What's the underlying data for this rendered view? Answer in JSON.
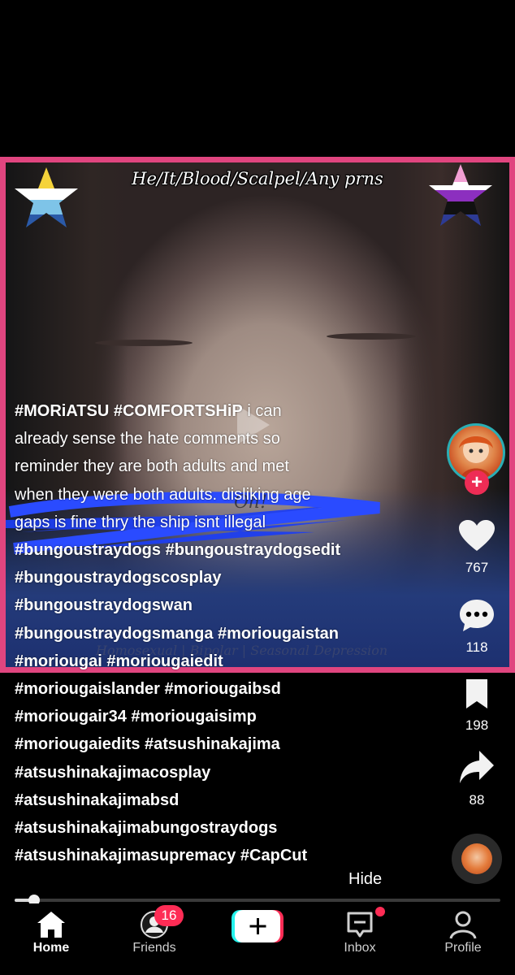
{
  "video": {
    "overlay_top_text": "He/It/Blood/Scalpel/Any prns",
    "overlay_mid_text": "Oh!",
    "overlay_bottom_text": "Homosexual | Bipolar | Seasonal Depression",
    "left_flag_colors": [
      "#f5d33a",
      "#ffffff",
      "#7ec4e8",
      "#2b5aa8"
    ],
    "right_flag_colors": [
      "#f29fd3",
      "#ffffff",
      "#8c2fbf",
      "#111111",
      "#2d3b94"
    ]
  },
  "caption": {
    "lines": [
      {
        "bold": "#MORiATSU #COMFORTSHiP",
        "text": " i can"
      },
      {
        "bold": "",
        "text": "already sense the hate comments so"
      },
      {
        "bold": "",
        "text": "reminder they are both adults and met"
      },
      {
        "bold": "",
        "text": "when they were both adults. disliking age"
      },
      {
        "bold": "",
        "text": "gaps is fine thry the ship isnt illegal"
      },
      {
        "bold": "#bungoustraydogs #bungoustraydogsedit",
        "text": ""
      },
      {
        "bold": "#bungoustraydogscosplay",
        "text": ""
      },
      {
        "bold": "#bungoustraydogswan",
        "text": ""
      },
      {
        "bold": "#bungoustraydogsmanga #moriougaistan",
        "text": ""
      },
      {
        "bold": "#moriougai #moriougaiedit",
        "text": ""
      },
      {
        "bold": "#moriougaislander #moriougaibsd",
        "text": ""
      },
      {
        "bold": "#moriougair34 #moriougaisimp",
        "text": ""
      },
      {
        "bold": "#moriougaiedits #atsushinakajima",
        "text": ""
      },
      {
        "bold": "#atsushinakajimacosplay",
        "text": ""
      },
      {
        "bold": "#atsushinakajimabsd",
        "text": ""
      },
      {
        "bold": "#atsushinakajimabungostraydogs",
        "text": ""
      },
      {
        "bold": "#atsushinakajimasupremacy #CapCut",
        "text": ""
      }
    ],
    "hide_label": "Hide"
  },
  "rail": {
    "likes": "767",
    "comments": "118",
    "saves": "198",
    "shares": "88",
    "follow_symbol": "+"
  },
  "progress": {
    "fraction": 0.04
  },
  "nav": {
    "home": "Home",
    "friends": "Friends",
    "friends_badge": "16",
    "create_symbol": "+",
    "inbox": "Inbox",
    "profile": "Profile"
  },
  "colors": {
    "frame_border": "#e0457f",
    "accent_red": "#fe2c55",
    "avatar_ring": "#2aaeb4",
    "create_left": "#25f4ee",
    "create_right": "#fe2c55"
  }
}
